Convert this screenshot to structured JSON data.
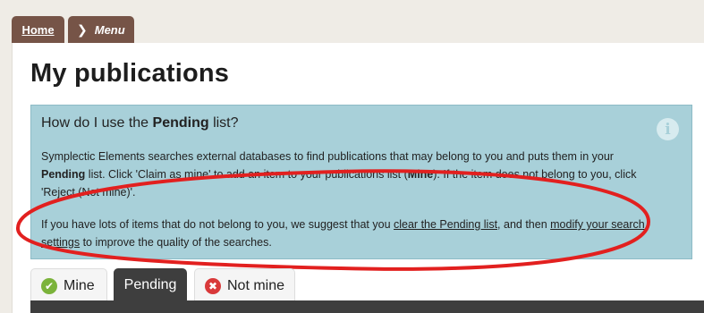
{
  "breadcrumb": {
    "home_label": "Home",
    "menu_label": "Menu",
    "menu_icon": "chevron-right-icon"
  },
  "page": {
    "title": "My publications"
  },
  "info_box": {
    "icon": "info-icon",
    "heading_pre": "How do I use the ",
    "heading_bold": "Pending",
    "heading_post": " list?",
    "p1_a": "Symplectic Elements searches external databases to find publications that may belong to you and puts them in your ",
    "p1_b": "Pending",
    "p1_c": " list. Click 'Claim as mine' to add an item to your publications list (",
    "p1_d": "Mine",
    "p1_e": "). If the item does not belong to you, click 'Reject (Not mine)'.",
    "p2_a": "If you have lots of items that do not belong to you, we suggest that you ",
    "p2_link1": "clear the Pending list",
    "p2_b": ", and then ",
    "p2_link2": "modify your search settings",
    "p2_c": " to improve the quality of the searches."
  },
  "tabs": [
    {
      "label": "Mine",
      "icon": "check-icon",
      "color": "#7bb33b"
    },
    {
      "label": "Pending",
      "active": true
    },
    {
      "label": "Not mine",
      "icon": "x-icon",
      "color": "#d9393a"
    }
  ],
  "colors": {
    "breadcrumb_bg": "#765447",
    "info_bg": "#a8d0d9",
    "annotation": "#e2201f",
    "active_tab": "#3e3e3e"
  }
}
